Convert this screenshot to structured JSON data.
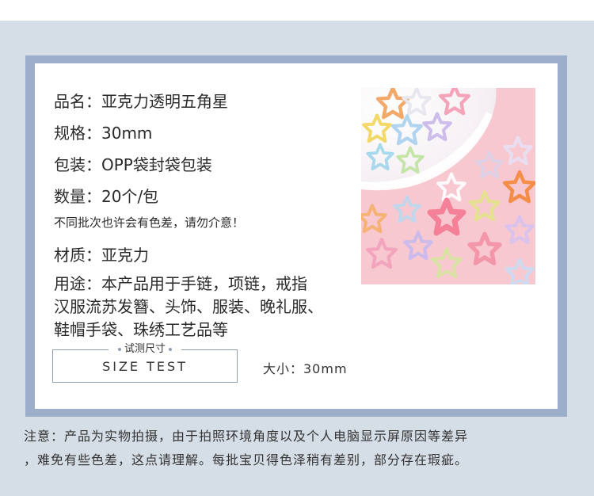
{
  "specs": {
    "name": "品名：亚克力透明五角星",
    "size": "规格：30mm",
    "packing": "包装：OPP袋封袋包装",
    "quantity": "数量：20个/包",
    "color_note": "不同批次也许会有色差，请勿介意！",
    "material": "材质：亚克力",
    "usage_lines": [
      "用途：本产品用于手链，项链，戒指",
      "汉服流苏发簪、头饰、服装、晚礼服、",
      "鞋帽手袋、珠绣工艺品等"
    ]
  },
  "size_test": {
    "title": "试测尺寸",
    "label": "SIZE TEST",
    "value": "大小：30mm"
  },
  "footer_note": {
    "lines": [
      "注意：产品为实物拍摄，由于拍照环境角度以及个人电脑显示屏原因等差异",
      "，难免有些色差，这点请理解。每批宝贝得色泽稍有差别，部分存在瑕疵。"
    ]
  },
  "colors": {
    "page_background": "#d5dde6",
    "frame": "#9daecb",
    "photo_background": "#f8c9d2"
  }
}
